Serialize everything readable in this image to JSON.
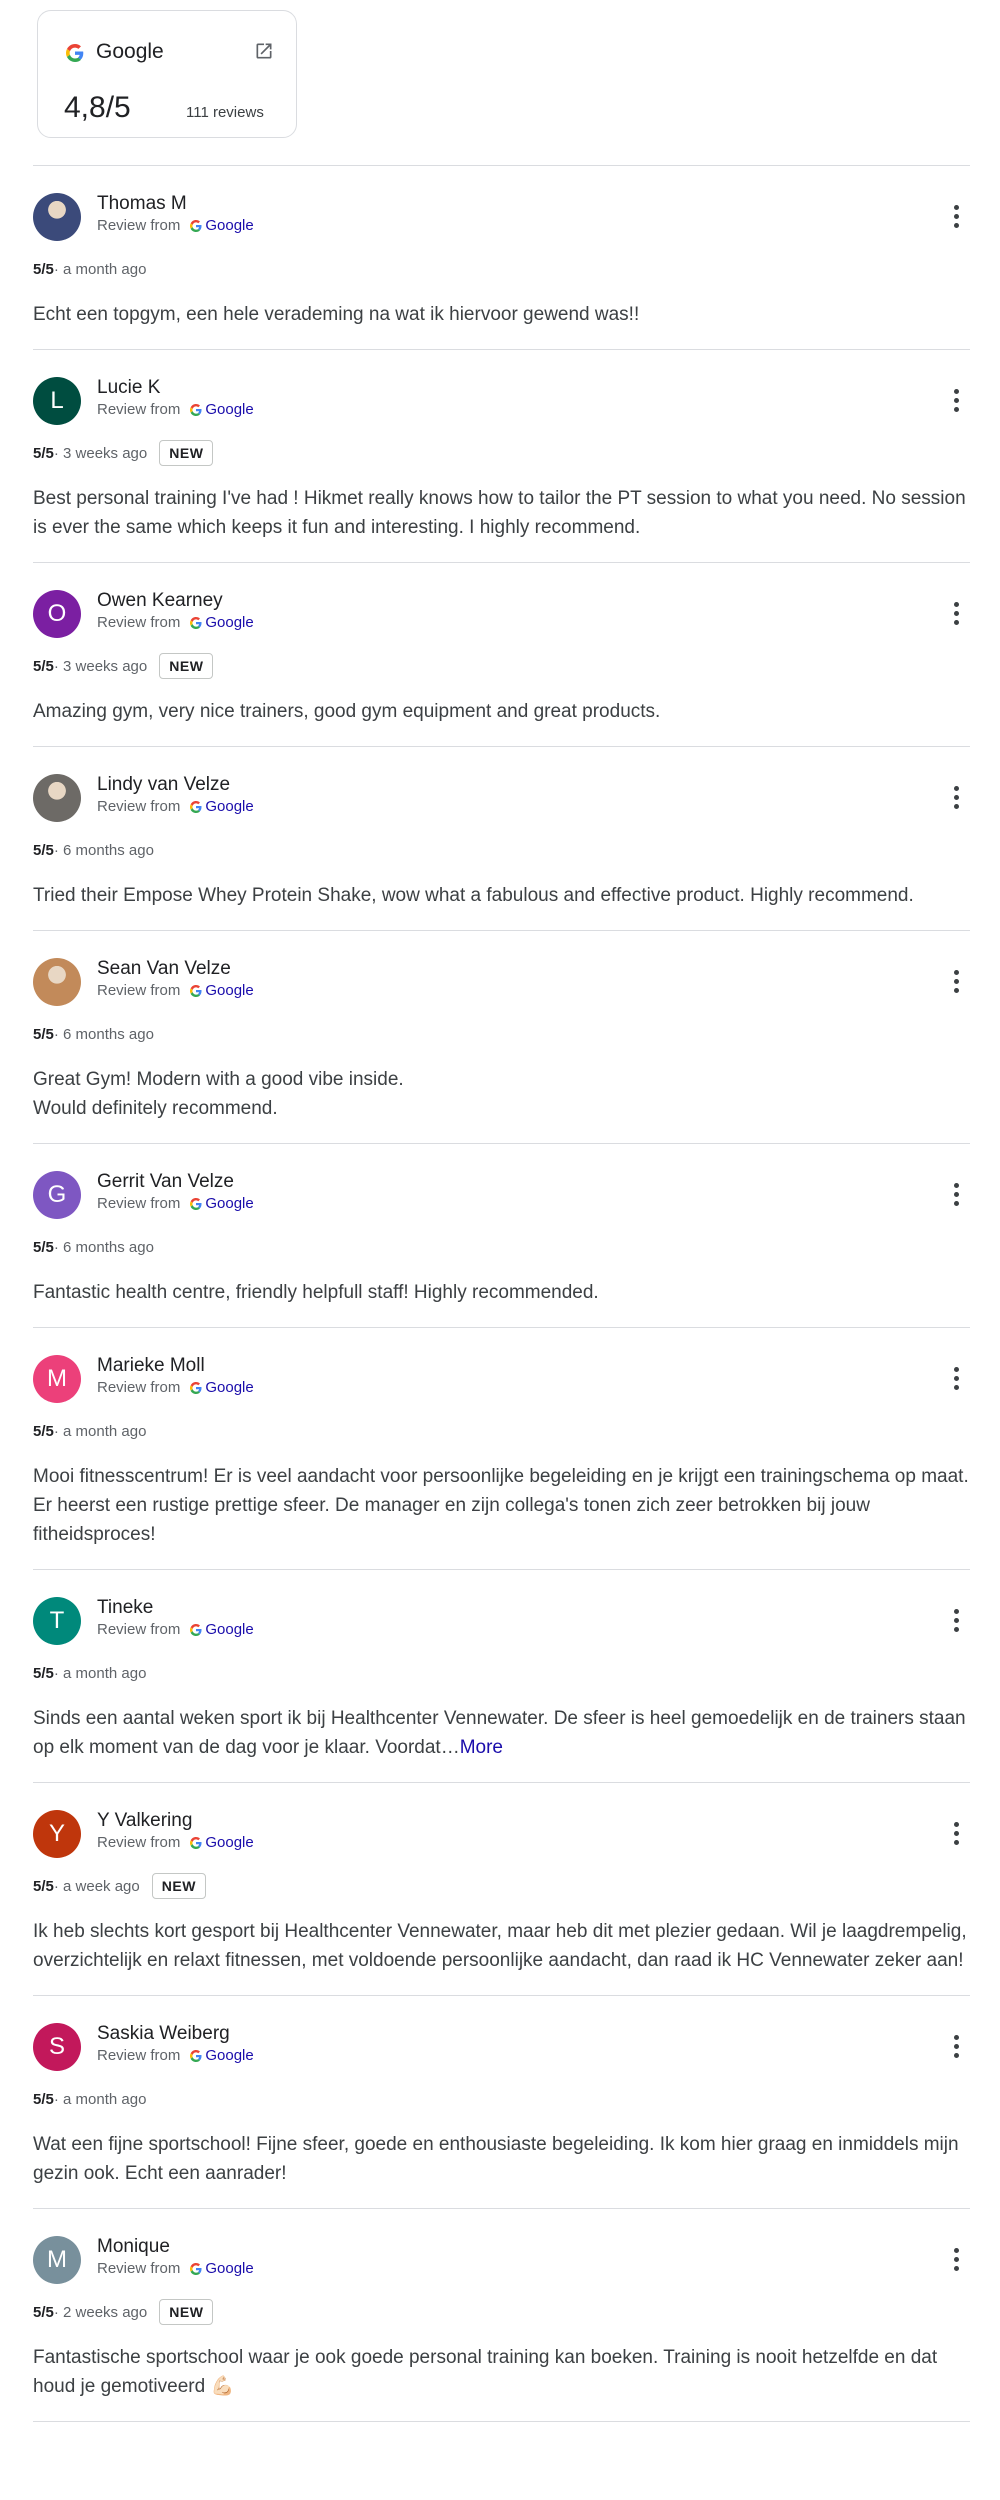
{
  "summary": {
    "source": "Google",
    "rating": "4,8/5",
    "reviews_count": "111 reviews",
    "icons": {
      "logo": "google-g-icon",
      "open": "external-link-icon"
    }
  },
  "review_source_label": "Review from",
  "review_source_name": "Google",
  "reviews": [
    {
      "author": "Thomas M",
      "score": "5/5",
      "time": " · a month ago",
      "badge": "",
      "text": "Echt een topgym, een hele verademing na wat ik hiervoor gewend was!!",
      "more": "",
      "avatar": {
        "type": "photo",
        "initial": "",
        "color": "#3b4a7a"
      }
    },
    {
      "author": "Lucie K",
      "score": "5/5",
      "time": " · 3 weeks ago",
      "badge": "NEW",
      "text": "Best personal training I've had ! Hikmet really knows how to tailor the PT session to what you need. No session is ever the same which keeps it fun and interesting. I highly recommend.",
      "more": "",
      "avatar": {
        "type": "initial",
        "initial": "L",
        "color": "#004d40"
      }
    },
    {
      "author": "Owen Kearney",
      "score": "5/5",
      "time": " · 3 weeks ago",
      "badge": "NEW",
      "text": "Amazing gym, very nice trainers, good gym equipment and great products.",
      "more": "",
      "avatar": {
        "type": "initial",
        "initial": "O",
        "color": "#7b1fa2"
      }
    },
    {
      "author": "Lindy van Velze",
      "score": "5/5",
      "time": " · 6 months ago",
      "badge": "",
      "text": "Tried their Empose Whey Protein Shake, wow what a fabulous and effective product. Highly recommend.",
      "more": "",
      "avatar": {
        "type": "photo",
        "initial": "",
        "color": "#6d6a66"
      }
    },
    {
      "author": "Sean Van Velze",
      "score": "5/5",
      "time": " · 6 months ago",
      "badge": "",
      "text": "Great Gym! Modern with a good vibe inside.\nWould definitely recommend.",
      "more": "",
      "avatar": {
        "type": "photo",
        "initial": "",
        "color": "#c28a5a"
      }
    },
    {
      "author": "Gerrit Van Velze",
      "score": "5/5",
      "time": " · 6 months ago",
      "badge": "",
      "text": "Fantastic health centre, friendly helpfull staff! Highly recommended.",
      "more": "",
      "avatar": {
        "type": "initial",
        "initial": "G",
        "color": "#7e57c2"
      }
    },
    {
      "author": "Marieke Moll",
      "score": "5/5",
      "time": " · a month ago",
      "badge": "",
      "text": "Mooi fitnesscentrum! Er is veel aandacht voor persoonlijke begeleiding en je krijgt een trainingschema op maat. Er heerst een rustige prettige sfeer. De manager en zijn collega's tonen zich zeer betrokken bij jouw fitheidsproces!",
      "more": "",
      "avatar": {
        "type": "initial",
        "initial": "M",
        "color": "#ec407a"
      }
    },
    {
      "author": "Tineke",
      "score": "5/5",
      "time": " · a month ago",
      "badge": "",
      "text": "Sinds een aantal weken sport ik bij Healthcenter Vennewater. De sfeer is heel gemoedelijk en de trainers staan op elk moment van de dag voor je klaar. Voordat…",
      "more": "More",
      "avatar": {
        "type": "initial",
        "initial": "T",
        "color": "#00897b"
      }
    },
    {
      "author": "Y Valkering",
      "score": "5/5",
      "time": " · a week ago",
      "badge": "NEW",
      "text": "Ik heb slechts kort gesport bij Healthcenter Vennewater, maar heb dit met plezier gedaan. Wil je laagdrempelig, overzichtelijk en relaxt fitnessen, met voldoende persoonlijke aandacht, dan raad ik HC Vennewater zeker aan!",
      "more": "",
      "avatar": {
        "type": "initial",
        "initial": "Y",
        "color": "#bf360c"
      }
    },
    {
      "author": "Saskia Weiberg",
      "score": "5/5",
      "time": " · a month ago",
      "badge": "",
      "text": "Wat een fijne sportschool! Fijne sfeer, goede en enthousiaste begeleiding. Ik kom hier graag en inmiddels mijn gezin ook. Echt een aanrader!",
      "more": "",
      "avatar": {
        "type": "initial",
        "initial": "S",
        "color": "#c2185b"
      }
    },
    {
      "author": "Monique",
      "score": "5/5",
      "time": " · 2 weeks ago",
      "badge": "NEW",
      "text": "Fantastische sportschool waar je ook goede personal training kan boeken. Training is nooit hetzelfde en dat houd je gemotiveerd 💪🏻",
      "more": "",
      "avatar": {
        "type": "initial",
        "initial": "M",
        "color": "#78909c"
      }
    }
  ]
}
